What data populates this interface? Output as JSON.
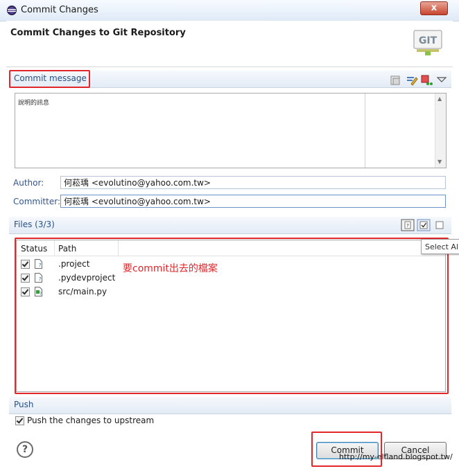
{
  "window": {
    "title": "Commit Changes",
    "close_label": "x"
  },
  "header": {
    "heading": "Commit Changes to Git Repository",
    "logo_text": "GIT"
  },
  "commit_message": {
    "section_title": "Commit message",
    "text": "說明的訊息"
  },
  "author": {
    "label": "Author:",
    "value": "何菘瑀 <evolutino@yahoo.com.tw>"
  },
  "committer": {
    "label": "Committer:",
    "value": "何菘瑀 <evolutino@yahoo.com.tw>"
  },
  "files": {
    "section_title": "Files (3/3)",
    "columns": [
      "Status",
      "Path"
    ],
    "rows": [
      {
        "path": ".project",
        "checked": true
      },
      {
        "path": ".pydevproject",
        "checked": true
      },
      {
        "path": "src/main.py",
        "checked": true
      }
    ],
    "annotation": "要commit出去的檔案",
    "tooltip": "Select Al"
  },
  "push": {
    "section_title": "Push",
    "checkbox_label": "Push the changes to upstream",
    "checked": true
  },
  "buttons": {
    "commit": "Commit",
    "cancel": "Cancel",
    "help": "?"
  },
  "watermark": "http://my-elfland.blogspot.tw/",
  "colors": {
    "highlight": "#e2262a",
    "section_title": "#274f86",
    "field_label": "#34558a"
  }
}
